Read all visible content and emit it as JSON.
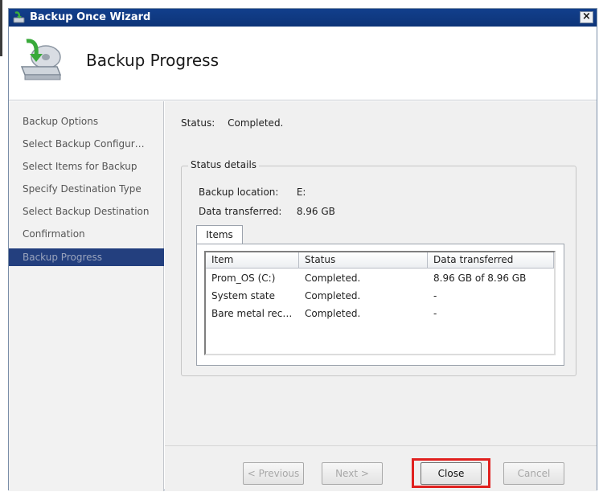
{
  "window": {
    "title": "Backup Once Wizard",
    "close_label": "×"
  },
  "header": {
    "title": "Backup Progress"
  },
  "sidebar": {
    "items": [
      {
        "label": "Backup Options"
      },
      {
        "label": "Select Backup Configur…"
      },
      {
        "label": "Select Items for Backup"
      },
      {
        "label": "Specify Destination Type"
      },
      {
        "label": "Select Backup Destination"
      },
      {
        "label": "Confirmation"
      },
      {
        "label": "Backup Progress",
        "active": true
      }
    ]
  },
  "status": {
    "label": "Status:",
    "value": "Completed."
  },
  "details": {
    "legend": "Status details",
    "location_label": "Backup location:",
    "location_value": "E:",
    "transferred_label": "Data transferred:",
    "transferred_value": "8.96 GB"
  },
  "tabs": {
    "items": "Items"
  },
  "table": {
    "columns": [
      "Item",
      "Status",
      "Data transferred"
    ],
    "rows": [
      {
        "item": "Prom_OS (C:)",
        "status": "Completed.",
        "data": "8.96 GB of 8.96 GB"
      },
      {
        "item": "System state",
        "status": "Completed.",
        "data": "-"
      },
      {
        "item": "Bare metal rec…",
        "status": "Completed.",
        "data": "-"
      }
    ]
  },
  "buttons": {
    "previous": "< Previous",
    "next": "Next >",
    "close": "Close",
    "cancel": "Cancel"
  },
  "colors": {
    "titlebar": "#123f8c",
    "active_nav": "#233f7e",
    "highlight": "#e0211f"
  }
}
